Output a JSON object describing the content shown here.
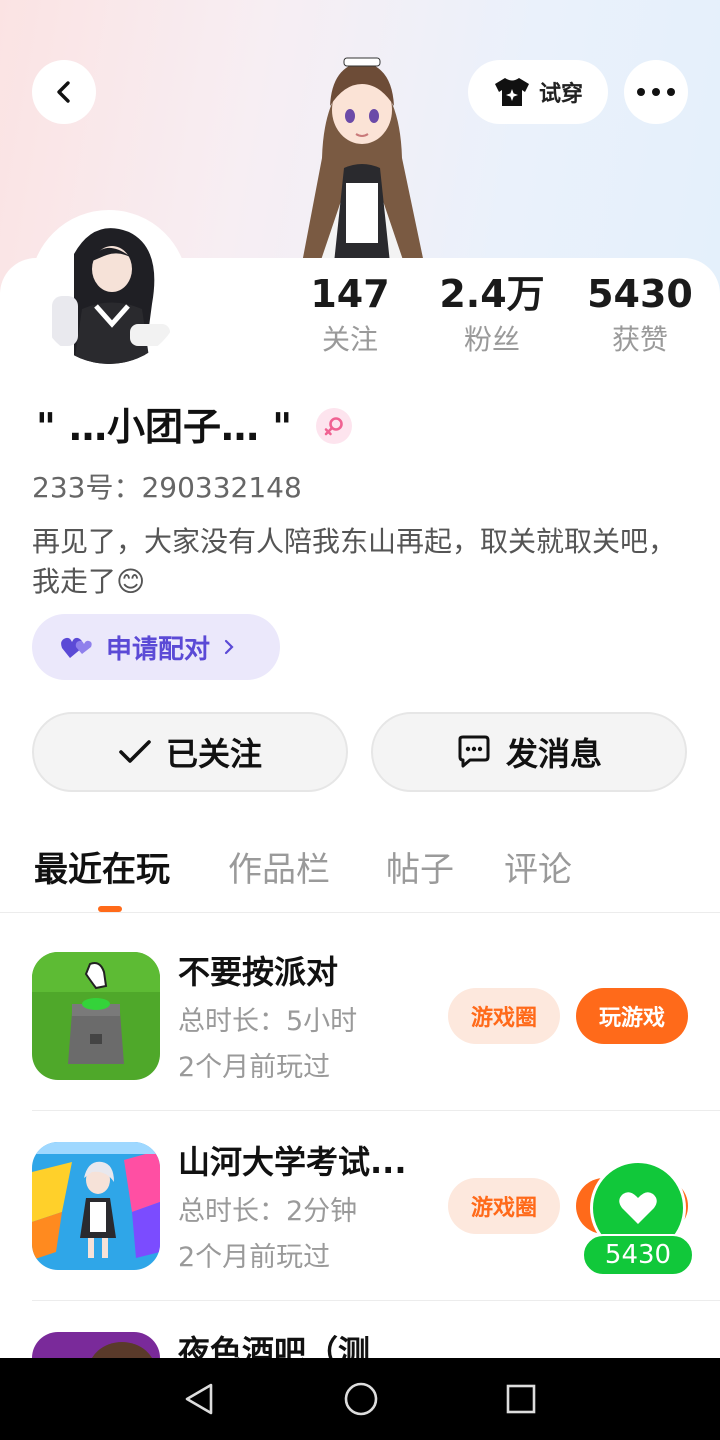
{
  "header": {
    "try_on_label": "试穿",
    "back_icon": "chevron-left-icon",
    "more_icon": "more-dots-icon",
    "tryon_icon": "shirt-sparkle-icon"
  },
  "stats": [
    {
      "value": "147",
      "label": "关注"
    },
    {
      "value": "2.4万",
      "label": "粉丝"
    },
    {
      "value": "5430",
      "label": "获赞"
    }
  ],
  "profile": {
    "nickname": "\" …小团子… \"",
    "gender_icon": "female-icon",
    "uid": "233号：290332148",
    "bio": "再见了，大家没有人陪我东山再起，取关就取关吧，我走了😊"
  },
  "pair_button": {
    "label": "申请配对",
    "icon": "hearts-icon"
  },
  "actions": {
    "follow_label": "已关注",
    "message_label": "发消息"
  },
  "tabs": [
    {
      "label": "最近在玩",
      "active": true
    },
    {
      "label": "作品栏",
      "active": false
    },
    {
      "label": "帖子",
      "active": false
    },
    {
      "label": "评论",
      "active": false
    }
  ],
  "games": [
    {
      "title": "不要按派对",
      "duration": "总时长：5小时",
      "last_played": "2个月前玩过",
      "circle_label": "游戏圈",
      "play_label": "玩游戏"
    },
    {
      "title": "山河大学考试...",
      "duration": "总时长：2分钟",
      "last_played": "2个月前玩过",
      "circle_label": "游戏圈",
      "play_label": "玩游戏"
    },
    {
      "title": "夜色酒吧（测"
    }
  ],
  "like_fab": {
    "count": "5430"
  },
  "colors": {
    "accent": "#ff6a1a",
    "pair": "#5b4ad6",
    "like": "#11c83a"
  }
}
